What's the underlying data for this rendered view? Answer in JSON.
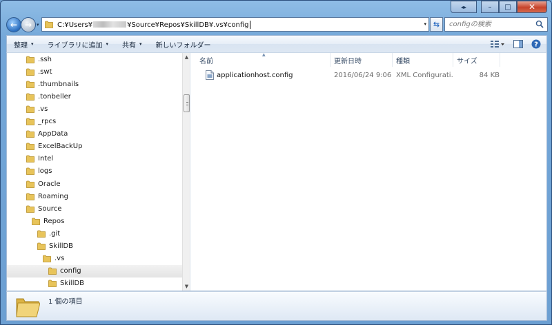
{
  "window": {
    "nav_glyph": "◂▸",
    "minimize_glyph": "–",
    "maximize_glyph": "□",
    "close_glyph": "✕"
  },
  "address": {
    "path_start": "C:¥Users¥",
    "path_end": "¥Source¥Repos¥SkillDB¥.vs¥config",
    "dropdown_glyph": "▾",
    "refresh_glyph": "⇆"
  },
  "search": {
    "placeholder": "configの検索"
  },
  "toolbar": {
    "organize": "整理",
    "add_to_library": "ライブラリに追加",
    "share": "共有",
    "new_folder": "新しいフォルダー",
    "dropdown_glyph": "▾"
  },
  "tree": {
    "items": [
      {
        "label": ".ssh",
        "level": 0
      },
      {
        "label": ".swt",
        "level": 0
      },
      {
        "label": ".thumbnails",
        "level": 0
      },
      {
        "label": ".tonbeller",
        "level": 0
      },
      {
        "label": ".vs",
        "level": 0
      },
      {
        "label": "_rpcs",
        "level": 0
      },
      {
        "label": "AppData",
        "level": 0
      },
      {
        "label": "ExcelBackUp",
        "level": 0
      },
      {
        "label": "Intel",
        "level": 0
      },
      {
        "label": "logs",
        "level": 0
      },
      {
        "label": "Oracle",
        "level": 0
      },
      {
        "label": "Roaming",
        "level": 0
      },
      {
        "label": "Source",
        "level": 0
      },
      {
        "label": "Repos",
        "level": 1
      },
      {
        "label": ".git",
        "level": 2
      },
      {
        "label": "SkillDB",
        "level": 2
      },
      {
        "label": ".vs",
        "level": 3
      },
      {
        "label": "config",
        "level": 4,
        "selected": true
      },
      {
        "label": "SkillDB",
        "level": 4
      }
    ]
  },
  "columns": {
    "name": "名前",
    "date": "更新日時",
    "type": "種類",
    "size": "サイズ"
  },
  "files": [
    {
      "name": "applicationhost.config",
      "date": "2016/06/24 9:06",
      "type": "XML Configurati...",
      "size": "84 KB"
    }
  ],
  "status": {
    "item_count": "1 個の項目"
  },
  "colors": {
    "frame": "#6c9fd2",
    "close_button": "#c7432a",
    "folder": "#e8c45a",
    "selection": "#e4e4e4"
  },
  "icons": [
    "back-icon",
    "forward-icon",
    "folder-icon",
    "refresh-icon",
    "search-icon",
    "view-icon",
    "preview-pane-icon",
    "help-icon",
    "config-file-icon"
  ]
}
